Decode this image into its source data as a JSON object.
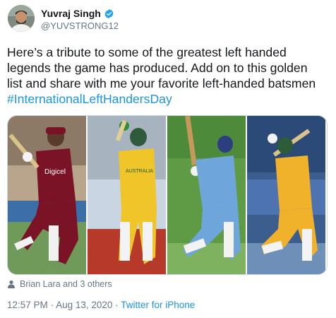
{
  "author": {
    "display_name": "Yuvraj Singh",
    "handle": "@YUVSTRONG12",
    "verified": true,
    "avatar_icon": "profile-photo"
  },
  "tweet": {
    "lines": [
      "Here’s a tribute to some of the greatest left handed",
      "legends the game has produced. Add on to this golden",
      "list and share with me your favorite left-handed batsmen"
    ],
    "hashtag": "#InternationalLeftHandersDay"
  },
  "media": {
    "photos": [
      {
        "jersey_text": "Digicel"
      },
      {
        "jersey_text": "AUSTRALIA"
      },
      {
        "jersey_text": ""
      },
      {
        "jersey_text": ""
      }
    ]
  },
  "tagged": {
    "icon": "person-icon",
    "text": "Brian Lara and 3 others"
  },
  "meta": {
    "time": "12:57 PM",
    "separator": "·",
    "date": "Aug 13, 2020",
    "source": "Twitter for iPhone"
  },
  "colors": {
    "link": "#1b95e0",
    "secondary_text": "#657786",
    "verified_badge": "#1da1f2"
  }
}
